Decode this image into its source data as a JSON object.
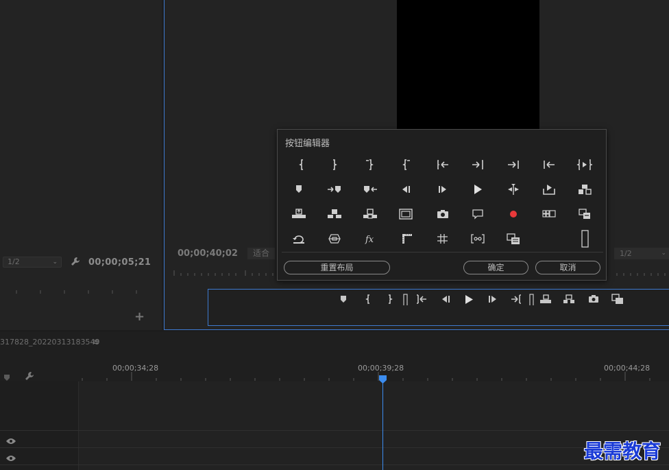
{
  "source": {
    "zoom": "1/2",
    "timecode": "00;00;05;21",
    "add": "+"
  },
  "program": {
    "timecode": "00;00;40;02",
    "fit": "适合",
    "resolution": "1/2"
  },
  "dialog": {
    "title": "按钮编辑器",
    "reset_label": "重置布局",
    "ok_label": "确定",
    "cancel_label": "取消"
  },
  "timeline": {
    "sequence_name": "317828_20220313183549",
    "menu": "≡",
    "timecodes": [
      "00;00;34;28",
      "00;00;39;28",
      "00;00;44;28"
    ]
  },
  "colors": {
    "accent": "#3e7ad0",
    "playhead": "#3c8df0",
    "record": "#e8393a"
  },
  "watermark": "最需教育"
}
